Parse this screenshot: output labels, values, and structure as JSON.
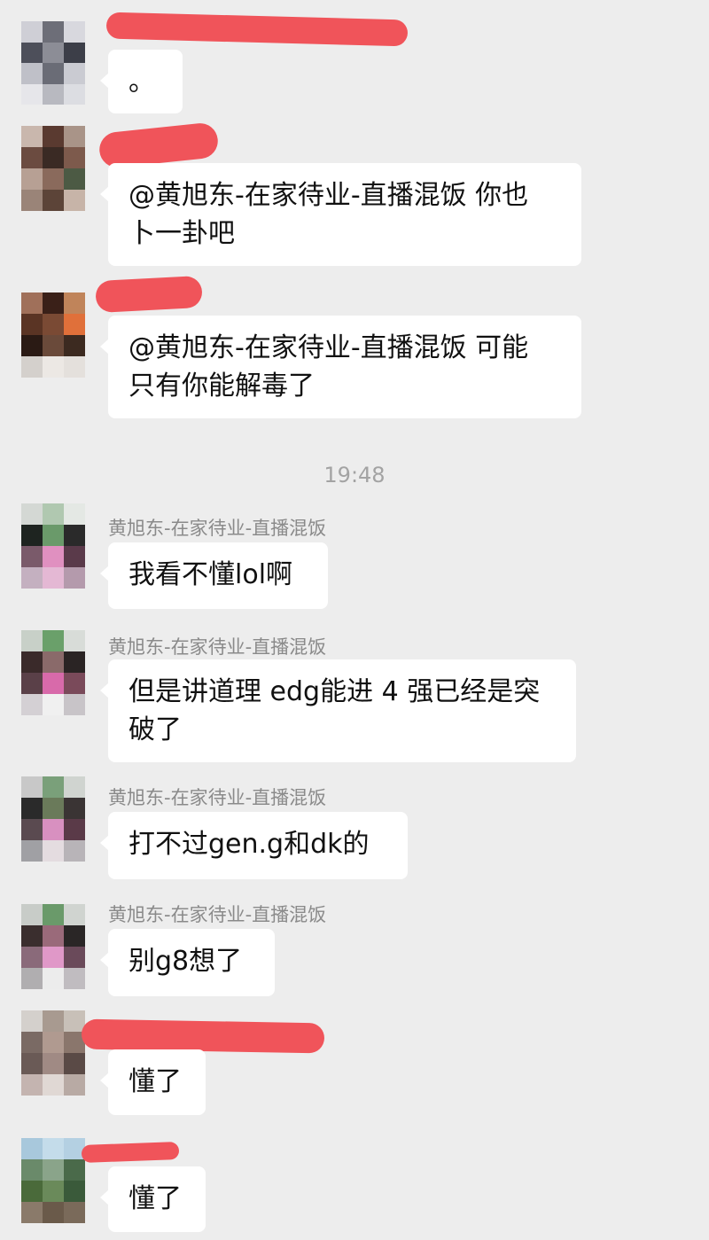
{
  "timestamp": "19:48",
  "messages": [
    {
      "sender": "",
      "text": "。"
    },
    {
      "sender": "",
      "text": "@黄旭东-在家待业-直播混饭 你也\n卜一卦吧"
    },
    {
      "sender": "",
      "text": "@黄旭东-在家待业-直播混饭 可能\n只有你能解毒了"
    },
    {
      "sender": "黄旭东-在家待业-直播混饭",
      "text": "我看不懂lol啊"
    },
    {
      "sender": "黄旭东-在家待业-直播混饭",
      "text": "但是讲道理 edg能进 4 强已经是突\n破了"
    },
    {
      "sender": "黄旭东-在家待业-直播混饭",
      "text": "打不过gen.g和dk的"
    },
    {
      "sender": "黄旭东-在家待业-直播混饭",
      "text": "别g8想了"
    },
    {
      "sender": "",
      "text": "懂了"
    },
    {
      "sender": "",
      "text": "懂了"
    }
  ]
}
